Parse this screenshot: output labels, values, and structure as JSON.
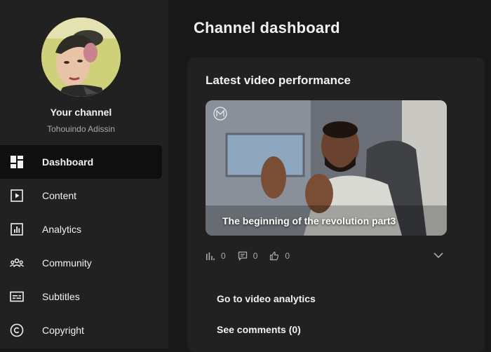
{
  "sidebar": {
    "channel_title": "Your channel",
    "channel_name": "Tohouindo Adissin",
    "items": [
      {
        "label": "Dashboard",
        "icon": "dashboard-icon",
        "active": true
      },
      {
        "label": "Content",
        "icon": "content-icon"
      },
      {
        "label": "Analytics",
        "icon": "analytics-icon"
      },
      {
        "label": "Community",
        "icon": "community-icon"
      },
      {
        "label": "Subtitles",
        "icon": "subtitles-icon"
      },
      {
        "label": "Copyright",
        "icon": "copyright-icon"
      }
    ]
  },
  "main": {
    "page_title": "Channel dashboard",
    "latest_video": {
      "section_title": "Latest video performance",
      "video_title": "The beginning of the revolution part3",
      "views": "0",
      "comments": "0",
      "likes": "0",
      "analytics_link": "Go to video analytics",
      "comments_link": "See comments (0)"
    }
  },
  "colors": {
    "background": "#181818",
    "sidebar": "#212121",
    "active_item": "#0f0f0f",
    "text_primary": "#f1f1f1",
    "text_secondary": "#aaaaaa"
  }
}
